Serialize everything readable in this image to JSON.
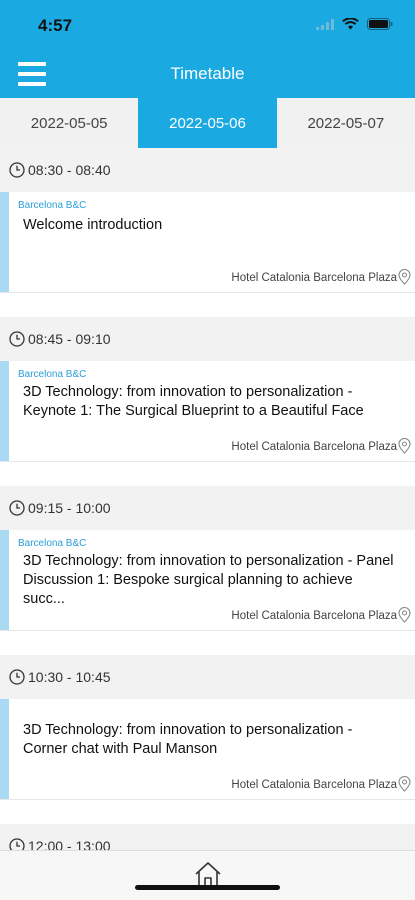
{
  "status_bar": {
    "time": "4:57"
  },
  "nav": {
    "title": "Timetable"
  },
  "date_tabs": [
    {
      "label": "2022-05-05",
      "active": false
    },
    {
      "label": "2022-05-06",
      "active": true
    },
    {
      "label": "2022-05-07",
      "active": false
    }
  ],
  "sessions": [
    {
      "time": "08:30 - 08:40",
      "org": "Barcelona B&C",
      "title": "Welcome introduction",
      "venue": "Hotel Catalonia Barcelona Plaza"
    },
    {
      "time": "08:45 - 09:10",
      "org": "Barcelona B&C",
      "title": "3D Technology: from innovation to personalization - Keynote 1: The Surgical Blueprint to a Beautiful Face",
      "venue": "Hotel Catalonia Barcelona Plaza"
    },
    {
      "time": "09:15 - 10:00",
      "org": "Barcelona B&C",
      "title": "3D Technology: from innovation to personalization - Panel Discussion 1: Bespoke surgical planning to achieve succ...",
      "venue": "Hotel Catalonia Barcelona Plaza"
    },
    {
      "time": "10:30 - 10:45",
      "org": "",
      "title": "3D Technology: from innovation to personalization - Corner chat with Paul Manson",
      "venue": "Hotel Catalonia Barcelona Plaza"
    },
    {
      "time": "12:00 - 13:00"
    }
  ],
  "icons": {
    "menu": "hamburger-icon",
    "clock": "clock-icon",
    "pin": "location-pin-icon",
    "home": "home-icon"
  },
  "colors": {
    "accent": "#1aa9e1",
    "card_stripe": "#a9d9f3",
    "org_text": "#2a9fd8"
  }
}
